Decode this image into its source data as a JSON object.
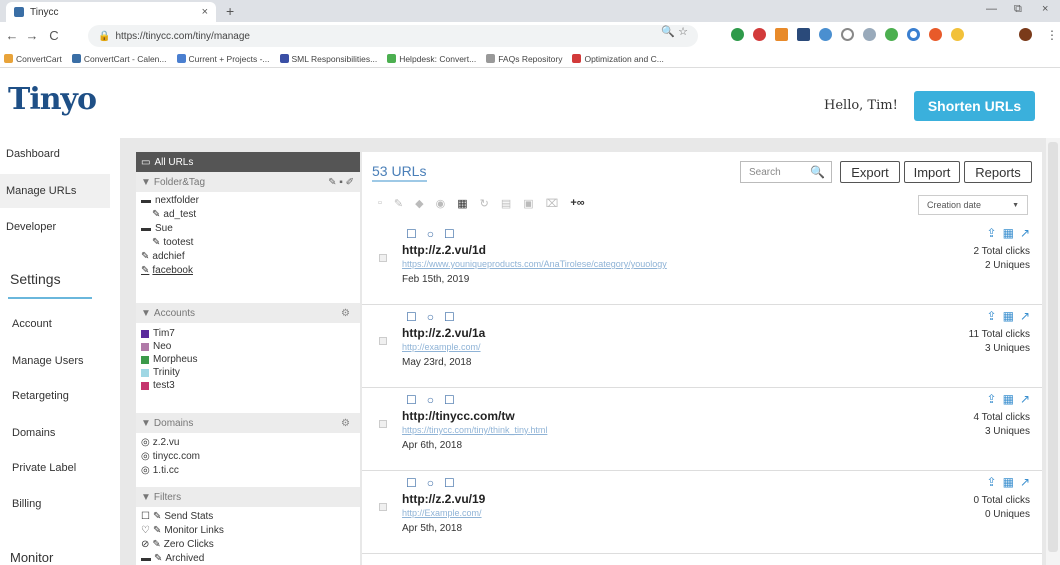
{
  "browser": {
    "tab_title": "Tinycc",
    "tab_close": "×",
    "new_tab": "+",
    "minimize": "—",
    "restore": "⧉",
    "close": "×",
    "back": "←",
    "forward": "→",
    "reload": "C",
    "url": "https://tinycc.com/tiny/manage",
    "omni_icons": "🔍 ☆",
    "menu": "⋮",
    "bookmarks": [
      {
        "label": "ConvertCart",
        "color": "#e8a33a"
      },
      {
        "label": "ConvertCart - Calen...",
        "color": "#3a6ea5"
      },
      {
        "label": "Current + Projects -...",
        "color": "#4a7fd0"
      },
      {
        "label": "SML Responsibilities...",
        "color": "#3a4fa5"
      },
      {
        "label": "Helpdesk: Convert...",
        "color": "#4caf50"
      },
      {
        "label": "FAQs Repository",
        "color": "#999999"
      },
      {
        "label": "Optimization and C...",
        "color": "#d23a3a"
      }
    ]
  },
  "header": {
    "logo": "Tinyo",
    "greeting": "Hello, Tim!",
    "shorten_button": "Shorten URLs"
  },
  "nav": {
    "dashboard": "Dashboard",
    "manage_urls": "Manage URLs",
    "developer": "Developer",
    "settings": "Settings",
    "account": "Account",
    "manage_users": "Manage Users",
    "retargeting": "Retargeting",
    "domains": "Domains",
    "private_label": "Private Label",
    "billing": "Billing",
    "monitor": "Monitor"
  },
  "folders": {
    "all_urls": "All URLs",
    "folder_tag": "Folder&Tag",
    "items": [
      "nextfolder",
      "ad_test",
      "Sue",
      "tootest",
      "adchief",
      "facebook"
    ],
    "accounts_header": "Accounts",
    "accounts": [
      {
        "name": "Tim7",
        "color": "#5b2a9c"
      },
      {
        "name": "Neo",
        "color": "#b07aa8"
      },
      {
        "name": "Morpheus",
        "color": "#3c9a4a"
      },
      {
        "name": "Trinity",
        "color": "#9fd7e4"
      },
      {
        "name": "test3",
        "color": "#c5356e"
      }
    ],
    "domains_header": "Domains",
    "domains": [
      "z.2.vu",
      "tinycc.com",
      "1.ti.cc"
    ],
    "filters_header": "Filters",
    "filters": [
      "Send Stats",
      "Monitor Links",
      "Zero Clicks",
      "Archived"
    ]
  },
  "main": {
    "count": "53 URLs",
    "search_placeholder": "Search",
    "export": "Export",
    "import": "Import",
    "reports": "Reports",
    "sort": "Creation date",
    "rows": [
      {
        "short": "http://z.2.vu/1d",
        "long": "https://www.youniqueproducts.com/AnaTirolese/category/youology",
        "date": "Feb 15th, 2019",
        "clicks": "2 Total clicks",
        "uniques": "2 Uniques"
      },
      {
        "short": "http://z.2.vu/1a",
        "long": "http://example.com/",
        "date": "May 23rd, 2018",
        "clicks": "11 Total clicks",
        "uniques": "3 Uniques"
      },
      {
        "short": "http://tinycc.com/tw",
        "long": "https://tinycc.com/tiny/think_tiny.html",
        "date": "Apr 6th, 2018",
        "clicks": "4 Total clicks",
        "uniques": "3 Uniques"
      },
      {
        "short": "http://z.2.vu/19",
        "long": "http://Example.com/",
        "date": "Apr 5th, 2018",
        "clicks": "0 Total clicks",
        "uniques": "0 Uniques"
      }
    ]
  }
}
